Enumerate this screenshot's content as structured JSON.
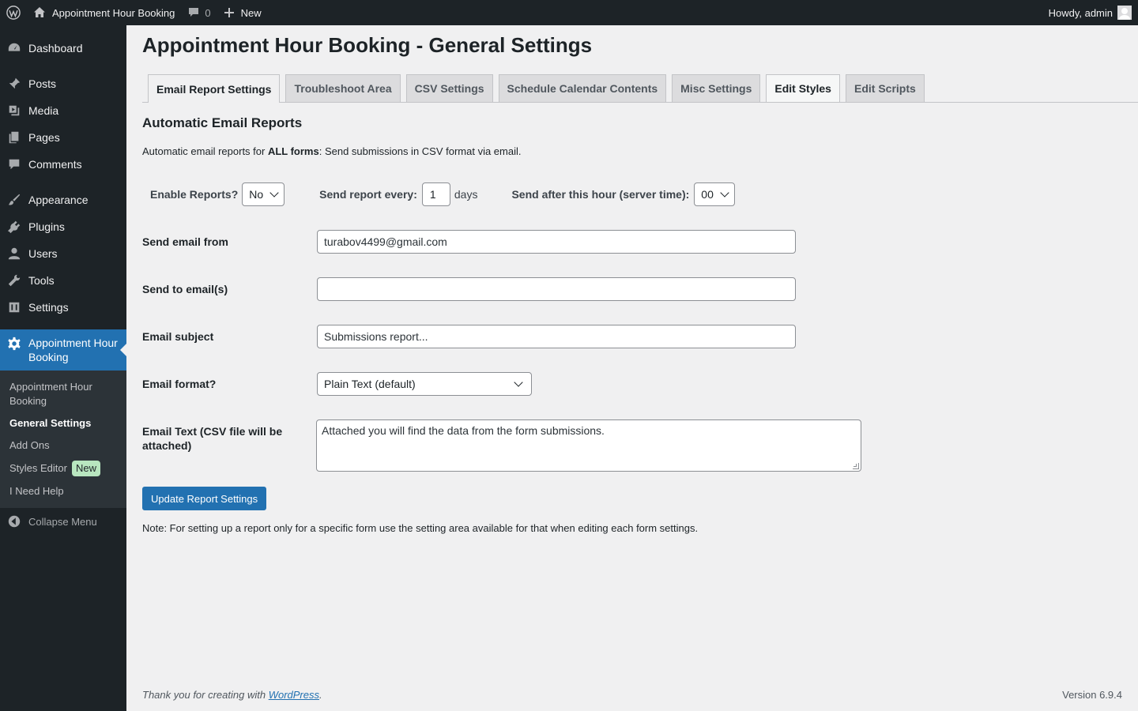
{
  "adminbar": {
    "site_name": "Appointment Hour Booking",
    "comments_count": "0",
    "new_label": "New",
    "howdy": "Howdy, admin"
  },
  "sidebar": {
    "items": [
      {
        "label": "Dashboard",
        "icon": "dashboard-icon"
      },
      {
        "label": "Posts",
        "icon": "pin-icon"
      },
      {
        "label": "Media",
        "icon": "media-icon"
      },
      {
        "label": "Pages",
        "icon": "pages-icon"
      },
      {
        "label": "Comments",
        "icon": "comment-icon"
      },
      {
        "label": "Appearance",
        "icon": "brush-icon"
      },
      {
        "label": "Plugins",
        "icon": "plugin-icon"
      },
      {
        "label": "Users",
        "icon": "user-icon"
      },
      {
        "label": "Tools",
        "icon": "wrench-icon"
      },
      {
        "label": "Settings",
        "icon": "settings-icon"
      }
    ],
    "active": {
      "label": "Appointment Hour Booking",
      "icon": "gear-icon"
    },
    "submenu": [
      {
        "label": "Appointment Hour Booking"
      },
      {
        "label": "General Settings"
      },
      {
        "label": "Add Ons"
      },
      {
        "label": "Styles Editor",
        "badge": "New"
      },
      {
        "label": "I Need Help"
      }
    ],
    "collapse": "Collapse Menu"
  },
  "page": {
    "title": "Appointment Hour Booking - General Settings",
    "tabs": [
      {
        "label": "Email Report Settings"
      },
      {
        "label": "Troubleshoot Area"
      },
      {
        "label": "CSV Settings"
      },
      {
        "label": "Schedule Calendar Contents"
      },
      {
        "label": "Misc Settings"
      },
      {
        "label": "Edit Styles"
      },
      {
        "label": "Edit Scripts"
      }
    ],
    "section_title": "Automatic Email Reports",
    "desc_prefix": "Automatic email reports for ",
    "desc_bold": "ALL forms",
    "desc_suffix": ": Send submissions in CSV format via email.",
    "enable_label": "Enable Reports?",
    "enable_value": "No",
    "every_label": "Send report every:",
    "every_value": "1",
    "every_unit": "days",
    "hour_label": "Send after this hour (server time):",
    "hour_value": "00",
    "from_label": "Send email from",
    "from_value": "turabov4499@gmail.com",
    "to_label": "Send to email(s)",
    "to_value": "",
    "subject_label": "Email subject",
    "subject_value": "Submissions report...",
    "format_label": "Email format?",
    "format_value": "Plain Text (default)",
    "text_label": "Email Text (CSV file will be attached)",
    "text_value": "Attached you will find the data from the form submissions.",
    "submit_label": "Update Report Settings",
    "note": "Note: For setting up a report only for a specific form use the setting area available for that when editing each form settings."
  },
  "footer": {
    "thanks_prefix": "Thank you for creating with ",
    "thanks_link": "WordPress",
    "thanks_suffix": ".",
    "version": "Version 6.9.4"
  }
}
